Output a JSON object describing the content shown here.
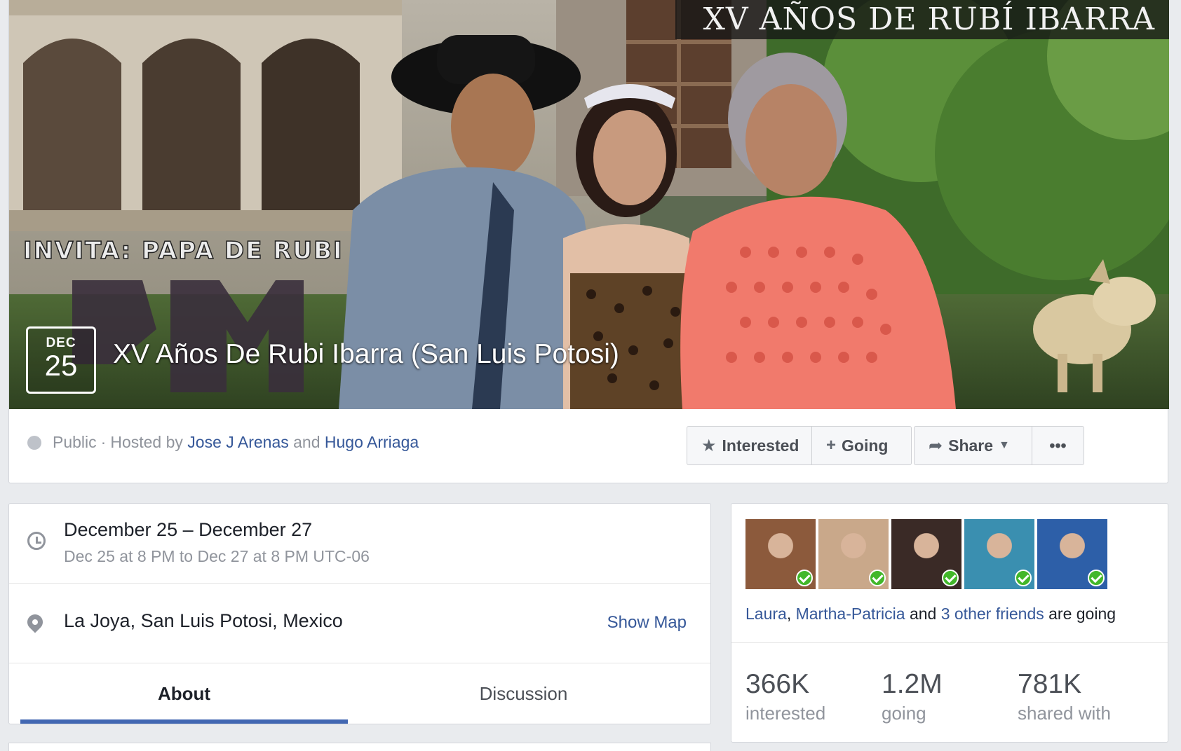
{
  "cover": {
    "banner_text": "XV AÑOS DE RUBÍ IBARRA",
    "invite_text": "INVITA: PAPA DE RUBI",
    "date_month": "DEC",
    "date_day": "25",
    "event_title": "XV Años De Rubi Ibarra (San Luis Potosi)"
  },
  "meta": {
    "privacy": "Public",
    "hosted_by_label": "Hosted by",
    "host1": "Jose J Arenas",
    "and": "and",
    "host2": "Hugo Arriaga"
  },
  "actions": {
    "interested": "Interested",
    "going": "Going",
    "share": "Share",
    "more": "•••"
  },
  "details": {
    "date_range": "December 25 – December 27",
    "time_range": "Dec 25 at 8 PM to Dec 27 at 8 PM UTC-06",
    "location": "La Joya, San Luis Potosi, Mexico",
    "show_map": "Show Map"
  },
  "tabs": [
    {
      "label": "About"
    },
    {
      "label": "Discussion"
    }
  ],
  "friends": {
    "avatar_colors": [
      "#8c5a3c",
      "#c9a88a",
      "#3a2a26",
      "#3a8fb0",
      "#2d5fa8"
    ],
    "name1": "Laura",
    "comma": ",",
    "name2": "Martha-Patricia",
    "and": "and",
    "others": "3 other friends",
    "suffix": "are going"
  },
  "stats": [
    {
      "value": "366K",
      "label": "interested"
    },
    {
      "value": "1.2M",
      "label": "going"
    },
    {
      "value": "781K",
      "label": "shared with"
    }
  ]
}
